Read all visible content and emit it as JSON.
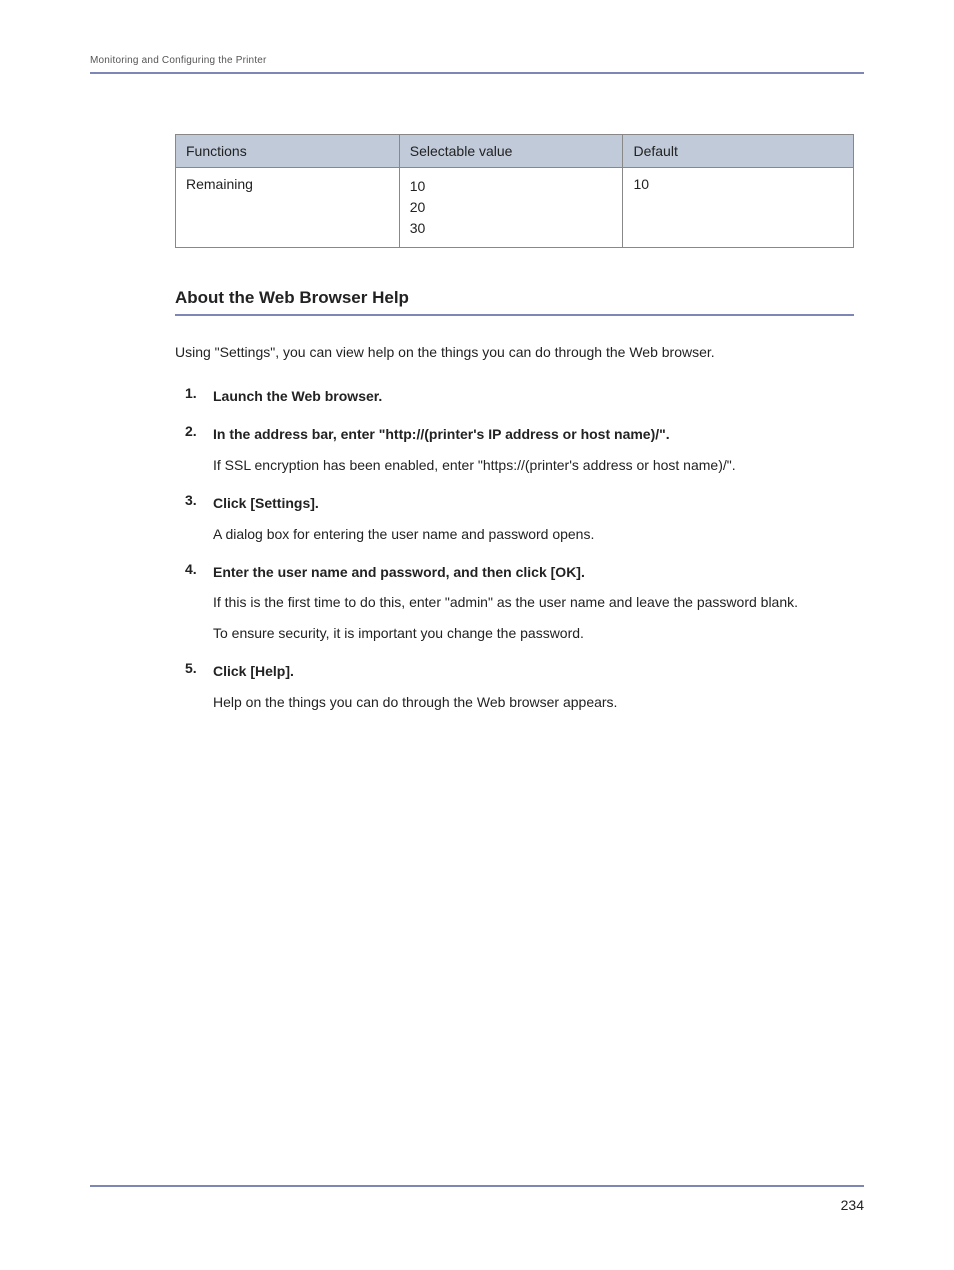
{
  "header": {
    "breadcrumb": "Monitoring and Configuring the Printer"
  },
  "table": {
    "headers": {
      "functions": "Functions",
      "selectable": "Selectable value",
      "default": "Default"
    },
    "row": {
      "functions": "Remaining",
      "selectable": "10\n20\n30",
      "default": "10"
    }
  },
  "section": {
    "heading": "About the Web Browser Help",
    "intro": "Using \"Settings\", you can view help on the things you can do through the Web browser."
  },
  "steps": [
    {
      "title": "Launch the Web browser.",
      "details": []
    },
    {
      "title": "In the address bar, enter \"http://(printer's IP address or host name)/\".",
      "details": [
        "If SSL encryption has been enabled, enter \"https://(printer's address or host name)/\"."
      ]
    },
    {
      "title": "Click [Settings].",
      "details": [
        "A dialog box for entering the user name and password opens."
      ]
    },
    {
      "title": "Enter the user name and password, and then click [OK].",
      "details": [
        "If this is the first time to do this, enter \"admin\" as the user name and leave the password blank.",
        "To ensure security, it is important you change the password."
      ]
    },
    {
      "title": "Click [Help].",
      "details": [
        "Help on the things you can do through the Web browser appears."
      ]
    }
  ],
  "footer": {
    "page": "234"
  }
}
